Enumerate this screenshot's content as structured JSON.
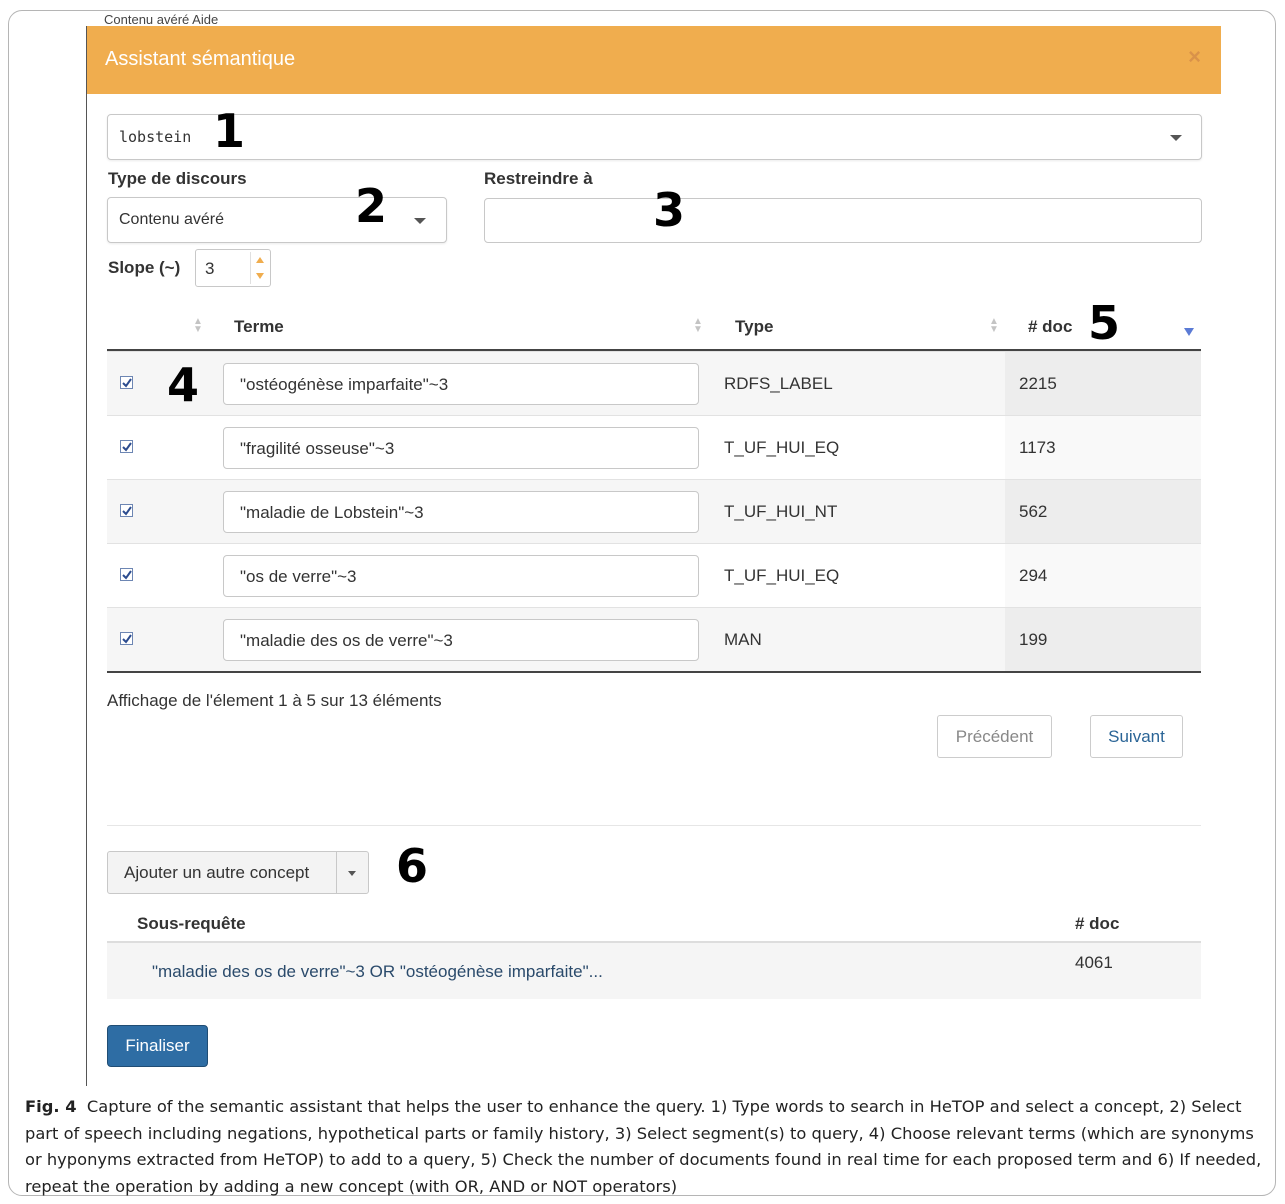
{
  "modal": {
    "title": "Assistant sémantique",
    "close_glyph": "×",
    "top_strip_text": "Contenu avéré      Aide"
  },
  "concept_select": {
    "value": "lobstein"
  },
  "discourse": {
    "label": "Type de discours",
    "value": "Contenu avéré"
  },
  "restrict": {
    "label": "Restreindre à",
    "value": ""
  },
  "slope": {
    "label": "Slope (~)",
    "value": "3"
  },
  "annotations": [
    "1",
    "2",
    "3",
    "4",
    "5",
    "6"
  ],
  "table": {
    "headers": {
      "term": "Terme",
      "type": "Type",
      "doc": "# doc"
    },
    "rows": [
      {
        "checked": true,
        "term": "\"ostéogénèse imparfaite\"~3",
        "type": "RDFS_LABEL",
        "doc": "2215"
      },
      {
        "checked": true,
        "term": "\"fragilité osseuse\"~3",
        "type": "T_UF_HUI_EQ",
        "doc": "1173"
      },
      {
        "checked": true,
        "term": "\"maladie de Lobstein\"~3",
        "type": "T_UF_HUI_NT",
        "doc": "562"
      },
      {
        "checked": true,
        "term": "\"os de verre\"~3",
        "type": "T_UF_HUI_EQ",
        "doc": "294"
      },
      {
        "checked": true,
        "term": "\"maladie des os de verre\"~3",
        "type": "MAN",
        "doc": "199"
      }
    ]
  },
  "pagination": {
    "info": "Affichage de l'élement 1 à 5 sur 13 éléments",
    "prev_label": "Précédent",
    "next_label": "Suivant"
  },
  "add_concept": {
    "label": "Ajouter un autre concept"
  },
  "subquery": {
    "header_label": "Sous-requête",
    "doc_header": "# doc",
    "query": "\"maladie des os de verre\"~3 OR \"ostéogénèse imparfaite\"...",
    "doc": "4061"
  },
  "finalize": {
    "label": "Finaliser"
  },
  "caption": {
    "label": "Fig. 4",
    "text": "Capture of the semantic assistant that helps the user to enhance the query. 1) Type words to search in HeTOP and select a concept, 2) Select part of speech including negations, hypothetical parts or family history, 3) Select segment(s) to query, 4) Choose relevant terms (which are synonyms or hyponyms extracted from HeTOP) to add to a query, 5) Check the number of documents found in real time for each proposed term and 6) If needed, repeat the operation by adding a new concept (with OR, AND or NOT operators)"
  },
  "colors": {
    "header_bg": "#f0ad4e",
    "primary_button": "#2e6da4",
    "link_blue": "#2a6496"
  }
}
